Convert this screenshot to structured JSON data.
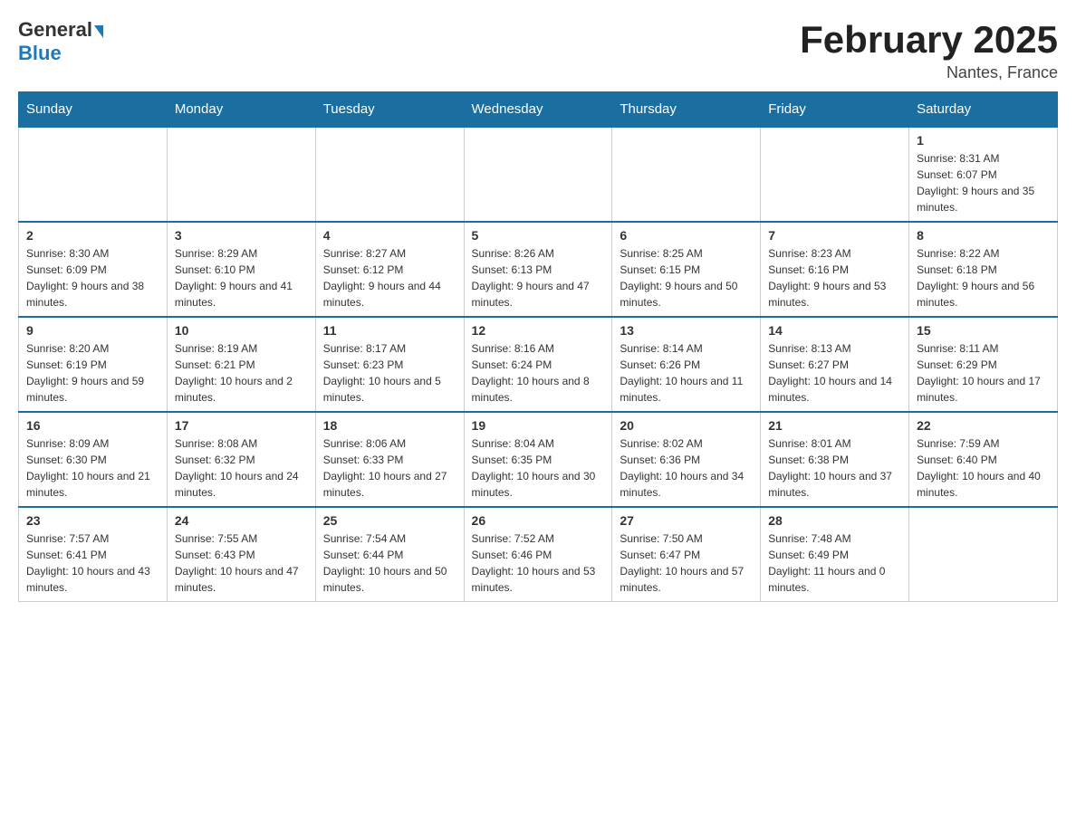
{
  "logo": {
    "general": "General",
    "blue": "Blue"
  },
  "title": "February 2025",
  "location": "Nantes, France",
  "days_of_week": [
    "Sunday",
    "Monday",
    "Tuesday",
    "Wednesday",
    "Thursday",
    "Friday",
    "Saturday"
  ],
  "weeks": [
    [
      {
        "day": "",
        "sunrise": "",
        "sunset": "",
        "daylight": ""
      },
      {
        "day": "",
        "sunrise": "",
        "sunset": "",
        "daylight": ""
      },
      {
        "day": "",
        "sunrise": "",
        "sunset": "",
        "daylight": ""
      },
      {
        "day": "",
        "sunrise": "",
        "sunset": "",
        "daylight": ""
      },
      {
        "day": "",
        "sunrise": "",
        "sunset": "",
        "daylight": ""
      },
      {
        "day": "",
        "sunrise": "",
        "sunset": "",
        "daylight": ""
      },
      {
        "day": "1",
        "sunrise": "Sunrise: 8:31 AM",
        "sunset": "Sunset: 6:07 PM",
        "daylight": "Daylight: 9 hours and 35 minutes."
      }
    ],
    [
      {
        "day": "2",
        "sunrise": "Sunrise: 8:30 AM",
        "sunset": "Sunset: 6:09 PM",
        "daylight": "Daylight: 9 hours and 38 minutes."
      },
      {
        "day": "3",
        "sunrise": "Sunrise: 8:29 AM",
        "sunset": "Sunset: 6:10 PM",
        "daylight": "Daylight: 9 hours and 41 minutes."
      },
      {
        "day": "4",
        "sunrise": "Sunrise: 8:27 AM",
        "sunset": "Sunset: 6:12 PM",
        "daylight": "Daylight: 9 hours and 44 minutes."
      },
      {
        "day": "5",
        "sunrise": "Sunrise: 8:26 AM",
        "sunset": "Sunset: 6:13 PM",
        "daylight": "Daylight: 9 hours and 47 minutes."
      },
      {
        "day": "6",
        "sunrise": "Sunrise: 8:25 AM",
        "sunset": "Sunset: 6:15 PM",
        "daylight": "Daylight: 9 hours and 50 minutes."
      },
      {
        "day": "7",
        "sunrise": "Sunrise: 8:23 AM",
        "sunset": "Sunset: 6:16 PM",
        "daylight": "Daylight: 9 hours and 53 minutes."
      },
      {
        "day": "8",
        "sunrise": "Sunrise: 8:22 AM",
        "sunset": "Sunset: 6:18 PM",
        "daylight": "Daylight: 9 hours and 56 minutes."
      }
    ],
    [
      {
        "day": "9",
        "sunrise": "Sunrise: 8:20 AM",
        "sunset": "Sunset: 6:19 PM",
        "daylight": "Daylight: 9 hours and 59 minutes."
      },
      {
        "day": "10",
        "sunrise": "Sunrise: 8:19 AM",
        "sunset": "Sunset: 6:21 PM",
        "daylight": "Daylight: 10 hours and 2 minutes."
      },
      {
        "day": "11",
        "sunrise": "Sunrise: 8:17 AM",
        "sunset": "Sunset: 6:23 PM",
        "daylight": "Daylight: 10 hours and 5 minutes."
      },
      {
        "day": "12",
        "sunrise": "Sunrise: 8:16 AM",
        "sunset": "Sunset: 6:24 PM",
        "daylight": "Daylight: 10 hours and 8 minutes."
      },
      {
        "day": "13",
        "sunrise": "Sunrise: 8:14 AM",
        "sunset": "Sunset: 6:26 PM",
        "daylight": "Daylight: 10 hours and 11 minutes."
      },
      {
        "day": "14",
        "sunrise": "Sunrise: 8:13 AM",
        "sunset": "Sunset: 6:27 PM",
        "daylight": "Daylight: 10 hours and 14 minutes."
      },
      {
        "day": "15",
        "sunrise": "Sunrise: 8:11 AM",
        "sunset": "Sunset: 6:29 PM",
        "daylight": "Daylight: 10 hours and 17 minutes."
      }
    ],
    [
      {
        "day": "16",
        "sunrise": "Sunrise: 8:09 AM",
        "sunset": "Sunset: 6:30 PM",
        "daylight": "Daylight: 10 hours and 21 minutes."
      },
      {
        "day": "17",
        "sunrise": "Sunrise: 8:08 AM",
        "sunset": "Sunset: 6:32 PM",
        "daylight": "Daylight: 10 hours and 24 minutes."
      },
      {
        "day": "18",
        "sunrise": "Sunrise: 8:06 AM",
        "sunset": "Sunset: 6:33 PM",
        "daylight": "Daylight: 10 hours and 27 minutes."
      },
      {
        "day": "19",
        "sunrise": "Sunrise: 8:04 AM",
        "sunset": "Sunset: 6:35 PM",
        "daylight": "Daylight: 10 hours and 30 minutes."
      },
      {
        "day": "20",
        "sunrise": "Sunrise: 8:02 AM",
        "sunset": "Sunset: 6:36 PM",
        "daylight": "Daylight: 10 hours and 34 minutes."
      },
      {
        "day": "21",
        "sunrise": "Sunrise: 8:01 AM",
        "sunset": "Sunset: 6:38 PM",
        "daylight": "Daylight: 10 hours and 37 minutes."
      },
      {
        "day": "22",
        "sunrise": "Sunrise: 7:59 AM",
        "sunset": "Sunset: 6:40 PM",
        "daylight": "Daylight: 10 hours and 40 minutes."
      }
    ],
    [
      {
        "day": "23",
        "sunrise": "Sunrise: 7:57 AM",
        "sunset": "Sunset: 6:41 PM",
        "daylight": "Daylight: 10 hours and 43 minutes."
      },
      {
        "day": "24",
        "sunrise": "Sunrise: 7:55 AM",
        "sunset": "Sunset: 6:43 PM",
        "daylight": "Daylight: 10 hours and 47 minutes."
      },
      {
        "day": "25",
        "sunrise": "Sunrise: 7:54 AM",
        "sunset": "Sunset: 6:44 PM",
        "daylight": "Daylight: 10 hours and 50 minutes."
      },
      {
        "day": "26",
        "sunrise": "Sunrise: 7:52 AM",
        "sunset": "Sunset: 6:46 PM",
        "daylight": "Daylight: 10 hours and 53 minutes."
      },
      {
        "day": "27",
        "sunrise": "Sunrise: 7:50 AM",
        "sunset": "Sunset: 6:47 PM",
        "daylight": "Daylight: 10 hours and 57 minutes."
      },
      {
        "day": "28",
        "sunrise": "Sunrise: 7:48 AM",
        "sunset": "Sunset: 6:49 PM",
        "daylight": "Daylight: 11 hours and 0 minutes."
      },
      {
        "day": "",
        "sunrise": "",
        "sunset": "",
        "daylight": ""
      }
    ]
  ]
}
